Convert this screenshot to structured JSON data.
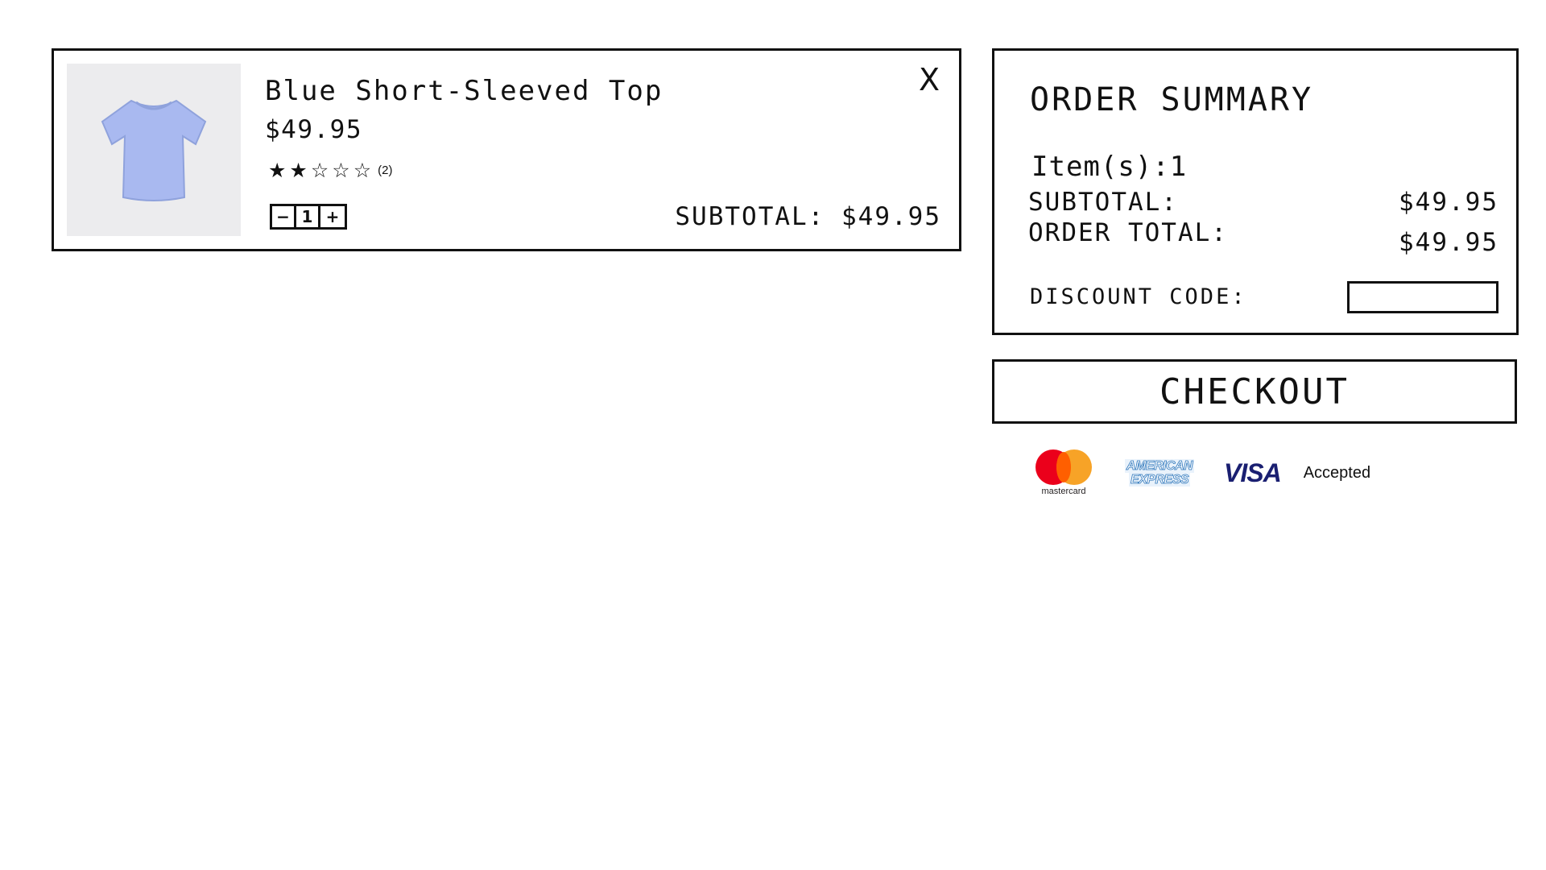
{
  "cart_item": {
    "name": "Blue Short-Sleeved Top",
    "price": "$49.95",
    "rating": 2,
    "rating_max": 5,
    "stars": [
      "★",
      "★",
      "☆",
      "☆",
      "☆"
    ],
    "rating_count": "(2)",
    "quantity": "1",
    "qty_minus": "−",
    "qty_plus": "+",
    "remove_icon": "X",
    "subtotal": "SUBTOTAL: $49.95",
    "shirt_color": "#a9b9f0"
  },
  "order_summary": {
    "title": "ORDER SUMMARY",
    "items": "Item(s):1",
    "subtotal_label": "SUBTOTAL:",
    "subtotal_value": "$49.95",
    "total_label": "ORDER TOTAL:",
    "total_value": "$49.95",
    "discount_label": "DISCOUNT CODE:",
    "discount_value": ""
  },
  "checkout": {
    "label": "CHECKOUT"
  },
  "payments": {
    "mastercard_text": "mastercard",
    "amex_line1": "AMERICAN",
    "amex_line2": "EXPRESS",
    "visa_text": "VISA",
    "accepted_text": "Accepted",
    "colors": {
      "mc_red": "#eb001b",
      "mc_yellow": "#f79e1b",
      "amex_blue": "#2e77bc",
      "visa_navy": "#1a1f71"
    }
  }
}
